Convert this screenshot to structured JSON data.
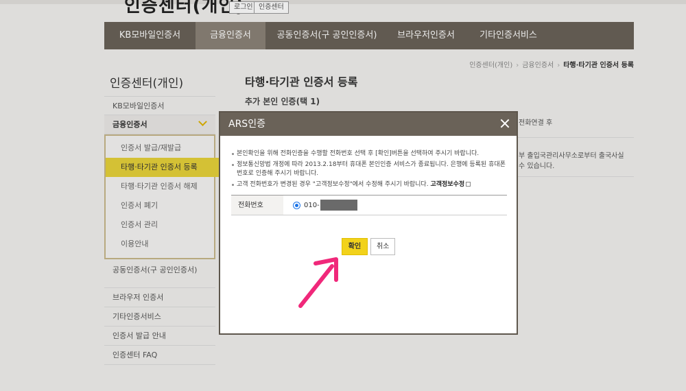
{
  "header": {
    "logo_title": "인증센터(개인)",
    "top_buttons": [
      "로그인",
      "인증센터"
    ]
  },
  "gnb": {
    "items": [
      {
        "label": "KB모바일인증서"
      },
      {
        "label": "금융인증서"
      },
      {
        "label": "공동인증서(구 공인인증서)"
      },
      {
        "label": "브라우저인증서"
      },
      {
        "label": "기타인증서비스"
      }
    ],
    "active_index": 1
  },
  "breadcrumb": [
    "인증센터(개인)",
    "금융인증서",
    "타행·타기관 인증서 등록"
  ],
  "lnb": {
    "title": "인증센터(개인)",
    "items": [
      "KB모바일인증서",
      "금융인증서",
      "공동인증서(구 공인인증서)",
      "브라우저 인증서",
      "기타인증서비스",
      "인증서 발급 안내",
      "인증센터 FAQ"
    ],
    "sub_items": [
      "인증서 발급/재발급",
      "타행·타기관 인증서 등록",
      "타행·타기관 인증서 해제",
      "인증서 폐기",
      "인증서 관리",
      "이용안내"
    ]
  },
  "content": {
    "title": "타행·타기관 인증서 등록",
    "subtitle": "추가 본인 인증(택 1)",
    "bg_text_1": "전화연결 후",
    "bg_text_2": "부 출입국관리사무소로부터 출국사실",
    "bg_text_3": "수 있습니다."
  },
  "modal": {
    "title": "ARS인증",
    "notices": [
      "본인확인을 위해 전화인증을 수행할 전화번호 선택 후 [확인]버튼을 선택하여 주시기 바랍니다.",
      "정보통신망법 개정에 따라 2013.2.18부터 휴대폰 본인인증 서비스가 종료됩니다. 은행에 등록된 휴대폰번호로 인증해 주시기 바랍니다.",
      "고객 전화번호가 변경된 경우 \"고객정보수정\"에서 수정해 주시기 바랍니다."
    ],
    "notice_link": "고객정보수정",
    "phone_label": "전화번호",
    "phone_prefix": "010-",
    "confirm_label": "확인",
    "cancel_label": "취소"
  },
  "colors": {
    "gnb_bg": "#6a6258",
    "accent_yellow": "#f2d21b",
    "arrow": "#f0287a"
  }
}
